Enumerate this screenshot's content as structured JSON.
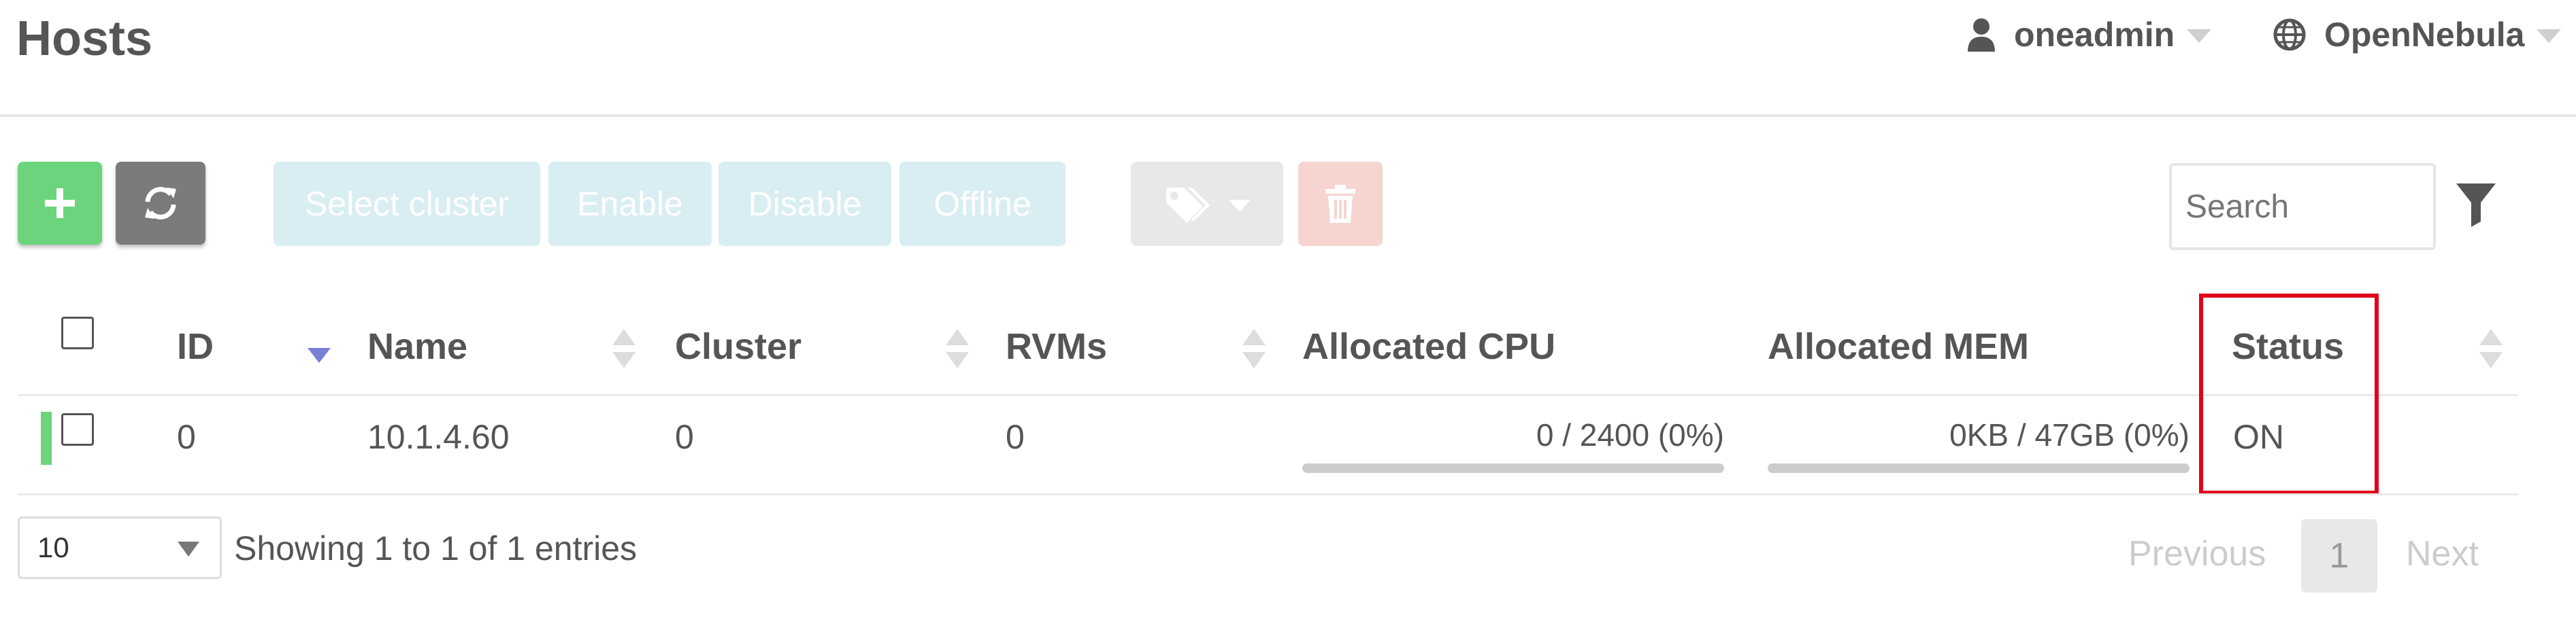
{
  "header": {
    "title": "Hosts",
    "user": {
      "label": "oneadmin",
      "icon": "user-icon"
    },
    "zone": {
      "label": "OpenNebula",
      "icon": "globe-icon"
    }
  },
  "toolbar": {
    "add_icon": "plus-icon",
    "refresh_icon": "refresh-icon",
    "select_cluster_label": "Select cluster",
    "enable_label": "Enable",
    "disable_label": "Disable",
    "offline_label": "Offline",
    "labels_icon": "tags-icon",
    "delete_icon": "trash-icon",
    "search_placeholder": "Search",
    "filter_icon": "filter-icon"
  },
  "table": {
    "columns": [
      "ID",
      "Name",
      "Cluster",
      "RVMs",
      "Allocated CPU",
      "Allocated MEM",
      "Status"
    ],
    "rows": [
      {
        "id": "0",
        "name": "10.1.4.60",
        "cluster": "0",
        "rvms": "0",
        "allocated_cpu": "0 / 2400 (0%)",
        "allocated_cpu_fraction": 0,
        "allocated_mem": "0KB / 47GB (0%)",
        "allocated_mem_fraction": 0,
        "status": "ON"
      }
    ]
  },
  "footer": {
    "page_length": "10",
    "info": "Showing 1 to 1 of 1 entries",
    "previous_label": "Previous",
    "current_page": "1",
    "next_label": "Next"
  },
  "colors": {
    "add": "#6cd47c",
    "refresh": "#7b7b7b",
    "cluster_actions": "#d9eef3",
    "delete": "#f6d4cf",
    "highlight": "#e0001a",
    "host_on": "#6cd47c"
  }
}
